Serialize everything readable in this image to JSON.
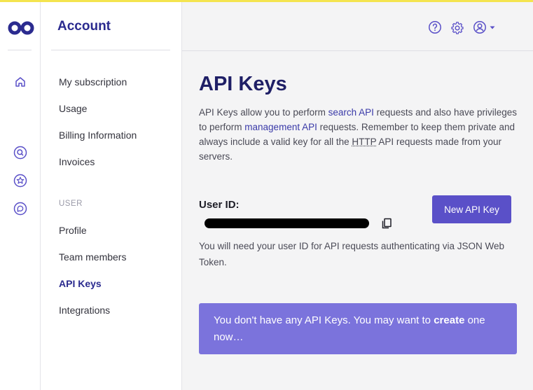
{
  "colors": {
    "accent": "#5a50c8",
    "brand": "#2b2b8f",
    "alert_bg": "#7b73dc",
    "topline": "#f4e44f"
  },
  "rail": {
    "icons": [
      "logo-icon",
      "home-icon",
      "search-icon",
      "star-icon",
      "chat-icon"
    ]
  },
  "sidebar": {
    "title": "Account",
    "items": [
      {
        "label": "My subscription"
      },
      {
        "label": "Usage"
      },
      {
        "label": "Billing Information"
      },
      {
        "label": "Invoices"
      }
    ],
    "section_label": "USER",
    "user_items": [
      {
        "label": "Profile"
      },
      {
        "label": "Team members"
      },
      {
        "label": "API Keys",
        "active": true
      },
      {
        "label": "Integrations"
      }
    ]
  },
  "header": {
    "icons": [
      "help-icon",
      "gear-icon",
      "user-icon",
      "caret-down-icon"
    ]
  },
  "main": {
    "title": "API Keys",
    "desc": {
      "p1": "API Keys allow you to perform ",
      "link1": "search API",
      "p2": " requests and also have privileges to perform ",
      "link2": "management API",
      "p3": " requests. Remember to keep them private and always include a valid key for all the ",
      "abbr": "HTTP",
      "p4": " API requests made from your servers."
    },
    "user_id_label": "User ID:",
    "new_key_button": "New API Key",
    "hint": "You will need your user ID for API requests authenticating via JSON Web Token.",
    "alert": {
      "text1": "You don't have any API Keys. You may want to ",
      "strong": "create",
      "text2": " one now…"
    }
  }
}
